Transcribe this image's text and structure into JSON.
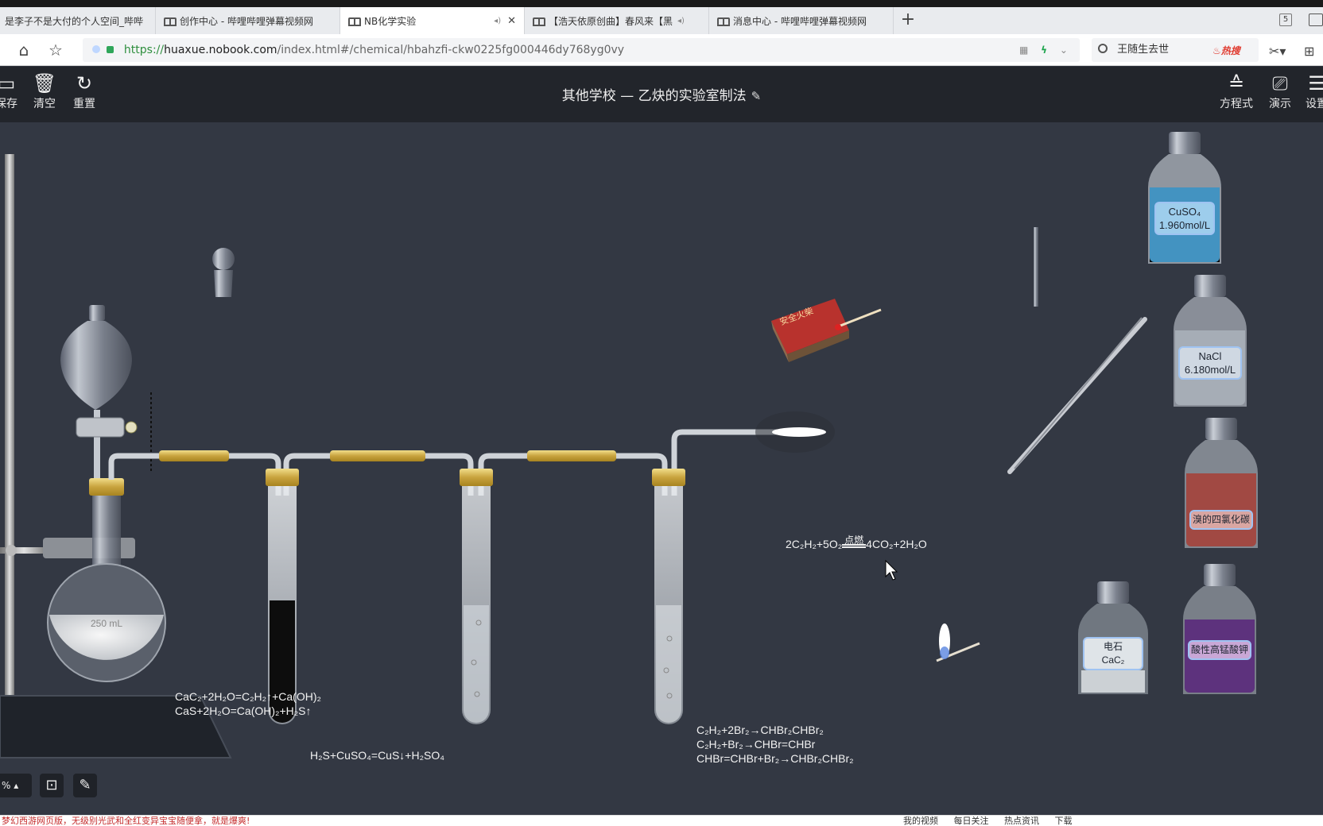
{
  "browser": {
    "tabs": [
      {
        "label": "是李子不是大付的个人空间_哔哔",
        "active": false
      },
      {
        "label": "创作中心 - 哔哩哔哩弹幕视频网",
        "active": false
      },
      {
        "label": "NB化学实验",
        "active": true
      },
      {
        "label": "【浩天依原创曲】春风来【黑",
        "active": false
      },
      {
        "label": "消息中心 - 哔哩哔哩弹幕视频网",
        "active": false
      }
    ],
    "tab_count": "5",
    "url": {
      "scheme": "https://",
      "host": "huaxue.nobook.com",
      "path": "/index.html#/chemical/hbahzfi-ckw0225fg000446dy768yg0vy"
    },
    "search_text": "王随生去世",
    "hot_label": "热搜"
  },
  "app": {
    "toolbar": {
      "save": "保存",
      "clear": "清空",
      "reset": "重置",
      "equation": "方程式",
      "present": "演示",
      "settings": "设置"
    },
    "title": "其他学校 — 乙炔的实验室制法",
    "zoom": "% ▴"
  },
  "workspace": {
    "flask_volume": "250 mL",
    "equations": {
      "generation": [
        "CaC₂+2H₂O=C₂H₂↑+Ca(OH)₂",
        "CaS+2H₂O=Ca(OH)₂+H₂S↑"
      ],
      "cuso4": "H₂S+CuSO₄=CuS↓+H₂SO₄",
      "bromine": [
        "C₂H₂+2Br₂→CHBr₂CHBr₂",
        "C₂H₂+Br₂→CHBr=CHBr",
        "CHBr=CHBr+Br₂→CHBr₂CHBr₂"
      ],
      "combustion_left": "2C₂H₂+5O₂",
      "combustion_condition": "点燃",
      "combustion_right": "4CO₂+2H₂O"
    },
    "reagents": [
      {
        "name": "CuSO₄",
        "conc": "1.960mol/L",
        "color": "#4aa3d6"
      },
      {
        "name": "NaCl",
        "conc": "6.180mol/L",
        "color": "#c9d2dc"
      },
      {
        "name": "溴的四氯化碳",
        "conc": "",
        "color": "#a4423b"
      },
      {
        "name": "电石",
        "conc": "CaC₂",
        "color": "#cfd4d8"
      },
      {
        "name": "酸性高锰酸钾",
        "conc": "",
        "color": "#5a2a7c"
      }
    ],
    "matchbox_label": "安全火柴"
  },
  "statusbar": {
    "left": "梦幻西游网页版，无级别光武和全红变异宝宝随便拿，就是爆爽!",
    "right_items": [
      "我的视频",
      "每日关注",
      "热点资讯",
      "下载"
    ]
  }
}
